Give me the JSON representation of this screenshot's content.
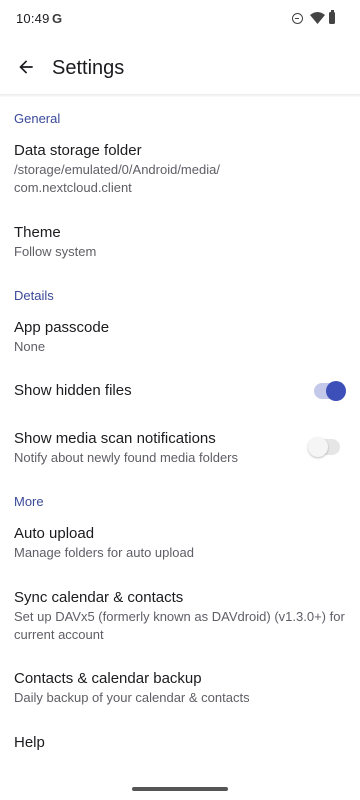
{
  "status_bar": {
    "time": "10:49",
    "g_label": "G",
    "icons": [
      "google-icon",
      "do-not-disturb-icon",
      "wifi-icon",
      "battery-icon"
    ]
  },
  "app_bar": {
    "back_icon": "arrow-back-icon",
    "title": "Settings"
  },
  "sections": {
    "general": "General",
    "details": "Details",
    "more": "More"
  },
  "prefs": {
    "data_storage": {
      "title": "Data storage folder",
      "summary_line1": "/storage/emulated/0/Android/media/",
      "summary_line2": "com.nextcloud.client"
    },
    "theme": {
      "title": "Theme",
      "summary": "Follow system"
    },
    "app_passcode": {
      "title": "App passcode",
      "summary": "None"
    },
    "show_hidden_files": {
      "title": "Show hidden files",
      "enabled": true
    },
    "media_scan": {
      "title": "Show media scan notifications",
      "summary": "Notify about newly found media folders",
      "enabled": false
    },
    "auto_upload": {
      "title": "Auto upload",
      "summary": "Manage folders for auto upload"
    },
    "sync_calendar": {
      "title": "Sync calendar & contacts",
      "summary_line1": "Set up DAVx5 (formerly known as DAVdroid) (v1.3.0+) for",
      "summary_line2": "current account"
    },
    "backup": {
      "title": "Contacts & calendar backup",
      "summary": "Daily backup of your calendar & contacts"
    },
    "help": {
      "title": "Help"
    }
  },
  "colors": {
    "accent": "#3d4fb8",
    "section_header": "#3b4a99",
    "toggle_on_track": "#c4c9ea",
    "toggle_off_track": "#e6e6e6"
  }
}
